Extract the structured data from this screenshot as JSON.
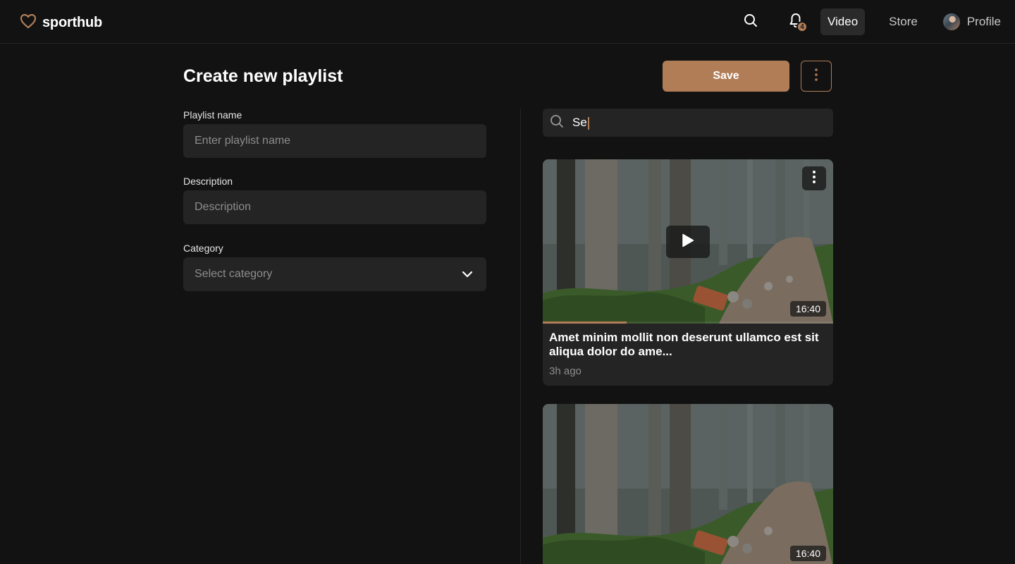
{
  "header": {
    "brand": "sporthub",
    "notifications_count": "4",
    "nav": [
      {
        "label": "Video",
        "active": true
      },
      {
        "label": "Store",
        "active": false
      }
    ],
    "profile_label": "Profile",
    "icons": [
      "heart-logo-icon",
      "search-icon",
      "bell-icon",
      "avatar"
    ]
  },
  "main": {
    "title": "Create new playlist",
    "save_label": "Save",
    "form": {
      "name_label": "Playlist name",
      "name_placeholder": "Enter playlist name",
      "description_label": "Description",
      "description_placeholder": "Description",
      "category_label": "Category",
      "category_placeholder": "Select category"
    },
    "search": {
      "value": "Se"
    },
    "videos": [
      {
        "title": "Amet minim mollit non deserunt ullamco est sit aliqua dolor do ame...",
        "time_ago": "3h ago",
        "duration": "16:40",
        "progress": 0.29
      },
      {
        "duration": "16:40"
      }
    ]
  },
  "colors": {
    "background": "#121212",
    "surface": "#242424",
    "accent": "#b17d57",
    "text": "#ffffff",
    "muted": "#8d8d8d"
  }
}
